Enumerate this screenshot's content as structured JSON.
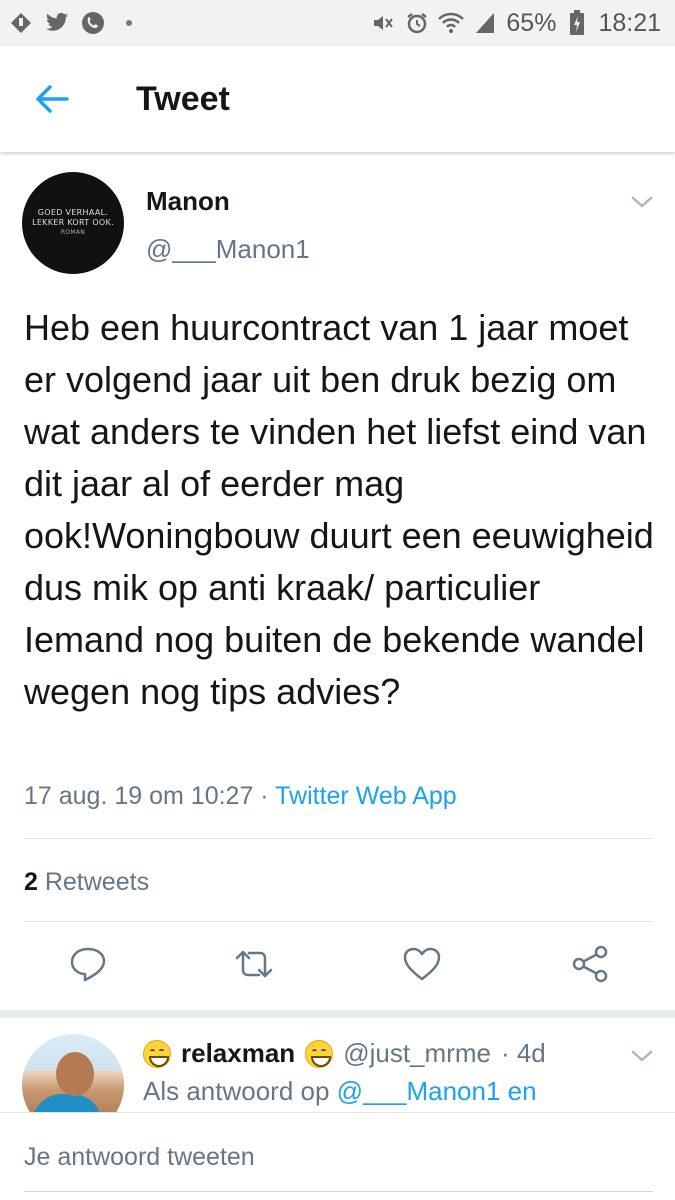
{
  "status_bar": {
    "battery": "65%",
    "time": "18:21"
  },
  "app_bar": {
    "title": "Tweet"
  },
  "tweet": {
    "author_name": "Manon",
    "author_handle": "@___Manon1",
    "avatar_text": [
      "GOED VERHAAL.",
      "LEKKER KORT OOK.",
      "ROMAN"
    ],
    "text": "Heb een huurcontract van 1 jaar moet er volgend jaar uit ben druk bezig om wat anders te vinden het liefst eind van dit jaar al of eerder mag ook!Woningbouw duurt een eeuwigheid dus mik op anti kraak/ particulier Iemand nog buiten de bekende wandel wegen nog tips advies?",
    "timestamp": "17 aug. 19 om 10:27",
    "separator": " · ",
    "source": "Twitter Web App",
    "retweet_count": "2",
    "retweet_label": " Retweets"
  },
  "reply": {
    "name": "relaxman",
    "handle": "@just_mrme",
    "age": "· 4d",
    "in_reply_prefix": "Als antwoord op ",
    "in_reply_mention": "@___Manon1",
    "in_reply_suffix": " en"
  },
  "compose": {
    "placeholder": "Je antwoord tweeten"
  },
  "colors": {
    "accent": "#1da1f2",
    "secondary_text": "#657786",
    "primary_text": "#14171a",
    "divider": "#e1e8ed"
  }
}
